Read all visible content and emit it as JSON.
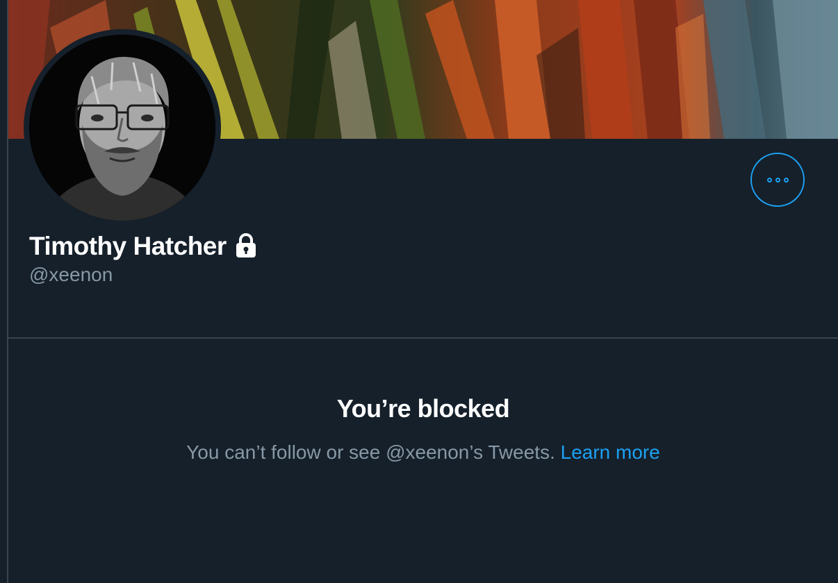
{
  "profile": {
    "display_name": "Timothy Hatcher",
    "handle": "@xeenon",
    "protected_icon": "lock-icon"
  },
  "actions": {
    "more_icon": "more-horizontal-icon"
  },
  "blocked": {
    "title": "You’re blocked",
    "message": "You can’t follow or see @xeenon’s Tweets.",
    "learn_more": "Learn more"
  },
  "colors": {
    "background": "#15202b",
    "accent": "#1da1f2",
    "secondary_text": "#8899a6",
    "divider": "#38444d"
  }
}
